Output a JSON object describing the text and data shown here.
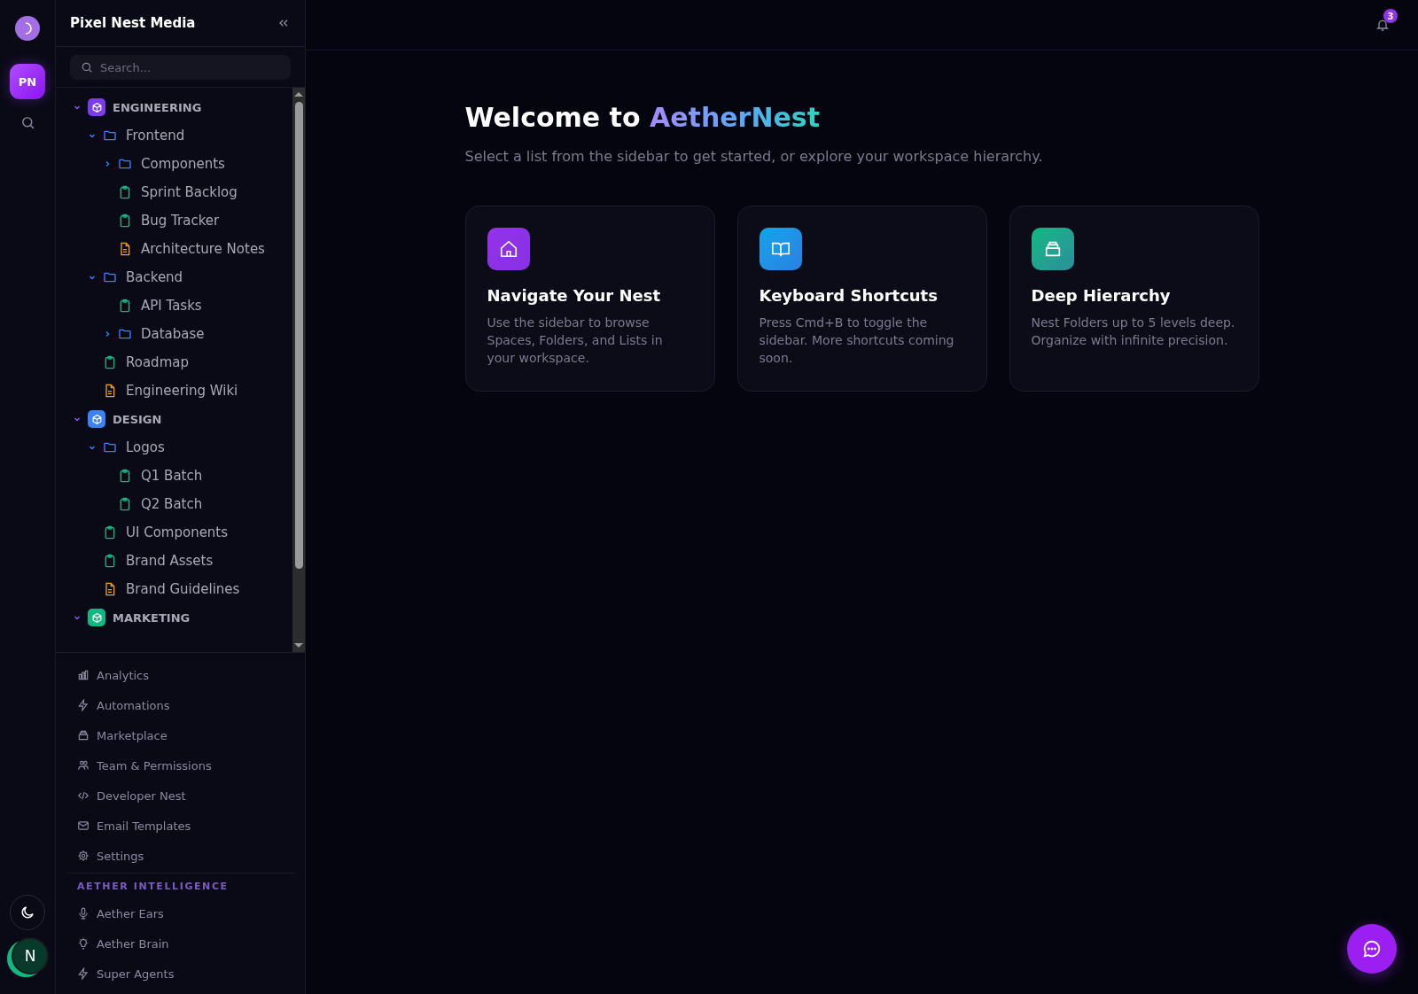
{
  "rail": {
    "workspace_initials": "PN",
    "avatar_initial": "N"
  },
  "sidebar": {
    "title": "Pixel Nest Media",
    "search": {
      "placeholder": "Search..."
    },
    "tree": [
      {
        "kind": "space",
        "label": "ENGINEERING",
        "color": "#7c3aed",
        "expanded": true,
        "children": [
          {
            "kind": "folder",
            "label": "Frontend",
            "expanded": true,
            "children": [
              {
                "kind": "folder",
                "label": "Components",
                "expanded": false
              },
              {
                "kind": "list",
                "label": "Sprint Backlog"
              },
              {
                "kind": "list",
                "label": "Bug Tracker"
              },
              {
                "kind": "doc",
                "label": "Architecture Notes"
              }
            ]
          },
          {
            "kind": "folder",
            "label": "Backend",
            "expanded": true,
            "children": [
              {
                "kind": "list",
                "label": "API Tasks"
              },
              {
                "kind": "folder",
                "label": "Database",
                "expanded": false
              }
            ]
          },
          {
            "kind": "list",
            "label": "Roadmap"
          },
          {
            "kind": "doc",
            "label": "Engineering Wiki"
          }
        ]
      },
      {
        "kind": "space",
        "label": "DESIGN",
        "color": "#3b82f6",
        "expanded": true,
        "children": [
          {
            "kind": "folder",
            "label": "Logos",
            "expanded": true,
            "children": [
              {
                "kind": "list",
                "label": "Q1 Batch"
              },
              {
                "kind": "list",
                "label": "Q2 Batch"
              }
            ]
          },
          {
            "kind": "list",
            "label": "UI Components"
          },
          {
            "kind": "list",
            "label": "Brand Assets"
          },
          {
            "kind": "doc",
            "label": "Brand Guidelines"
          }
        ]
      },
      {
        "kind": "space",
        "label": "MARKETING",
        "color": "#10b981",
        "expanded": true
      }
    ],
    "nav_items": [
      "Analytics",
      "Automations",
      "Marketplace",
      "Team & Permissions",
      "Developer Nest",
      "Email Templates",
      "Settings"
    ],
    "ai_section": {
      "title": "AETHER INTELLIGENCE",
      "items": [
        "Aether Ears",
        "Aether Brain",
        "Super Agents"
      ]
    }
  },
  "topbar": {
    "notification_count": "3"
  },
  "welcome": {
    "title": "Welcome to",
    "highlight": "AetherNest",
    "subtitle": "Select a list from the sidebar to get started, or explore your workspace hierarchy."
  },
  "cards": [
    {
      "title": "Navigate Your Nest",
      "text": "Use the sidebar to browse Spaces, Folders, and Lists in your workspace.",
      "color": "#9333ea"
    },
    {
      "title": "Keyboard Shortcuts",
      "text": "Press Cmd+B to toggle the sidebar. More shortcuts coming soon.",
      "color": "#0ea5e9"
    },
    {
      "title": "Deep Hierarchy",
      "text": "Nest Folders up to 5 levels deep. Organize with infinite precision.",
      "color": "#10b981"
    }
  ]
}
